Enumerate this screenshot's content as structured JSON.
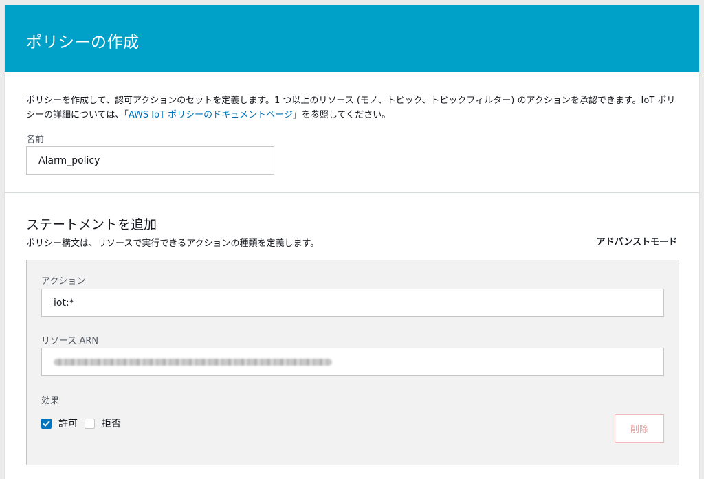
{
  "header": {
    "title": "ポリシーの作成"
  },
  "intro": {
    "text_before_link": "ポリシーを作成して、認可アクションのセットを定義します。1 つ以上のリソース (モノ、トピック、トピックフィルター) のアクションを承認できます。IoT ポリシーの詳細については、「",
    "link_text": "AWS IoT ポリシーのドキュメントページ",
    "text_after_link": "」を参照してください。"
  },
  "name_field": {
    "label": "名前",
    "value": "Alarm_policy"
  },
  "statement_section": {
    "title": "ステートメントを追加",
    "description": "ポリシー構文は、リソースで実行できるアクションの種類を定義します。",
    "advanced_mode_label": "アドバンストモード"
  },
  "statement": {
    "action_label": "アクション",
    "action_value": "iot:*",
    "resource_label": "リソース ARN",
    "resource_value_state": "blurred",
    "effect_label": "効果",
    "allow_label": "許可",
    "allow_checked": true,
    "deny_label": "拒否",
    "deny_checked": false,
    "delete_label": "削除"
  },
  "colors": {
    "header_bg": "#00a1c9",
    "link": "#0073bb",
    "checkbox_checked": "#0073bb",
    "delete_border": "#f0b8b8"
  }
}
